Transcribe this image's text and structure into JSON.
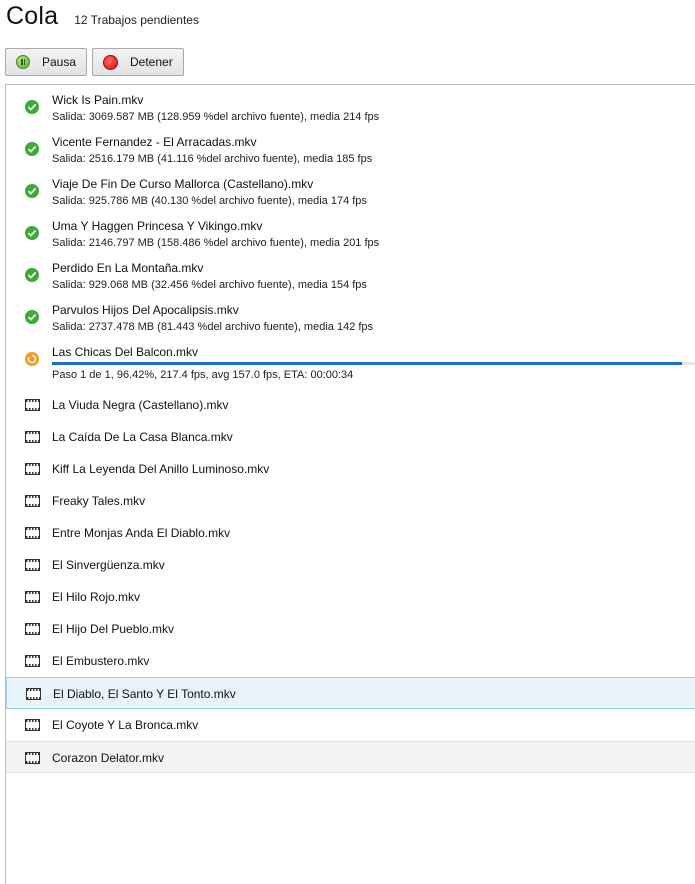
{
  "header": {
    "title": "Cola",
    "subtitle": "12 Trabajos pendientes"
  },
  "toolbar": {
    "pause_label": "Pausa",
    "stop_label": "Detener"
  },
  "colors": {
    "done": "#3cab35",
    "running": "#f59a1d",
    "progress": "#1b6ec2",
    "selected_bg": "#e8f4fa"
  },
  "queue": {
    "completed": [
      {
        "name": "Wick Is Pain.mkv",
        "detail": "Salida: 3069.587 MB (128.959 %del archivo fuente), media 214 fps"
      },
      {
        "name": "Vicente Fernandez - El Arracadas.mkv",
        "detail": "Salida: 2516.179 MB (41.116 %del archivo fuente), media 185 fps"
      },
      {
        "name": "Viaje De Fin De Curso Mallorca (Castellano).mkv",
        "detail": "Salida: 925.786 MB (40.130 %del archivo fuente), media 174 fps"
      },
      {
        "name": "Uma Y Haggen Princesa Y Vikingo.mkv",
        "detail": "Salida: 2146.797 MB (158.486 %del archivo fuente), media 201 fps"
      },
      {
        "name": "Perdido En La Montaña.mkv",
        "detail": "Salida: 929.068 MB (32.456 %del archivo fuente), media 154 fps"
      },
      {
        "name": "Parvulos Hijos Del Apocalipsis.mkv",
        "detail": "Salida: 2737.478 MB (81.443 %del archivo fuente), media 142 fps"
      }
    ],
    "running": {
      "name": "Las Chicas Del Balcon.mkv",
      "detail": "Paso 1 de 1, 96.42%, 217.4 fps, avg 157.0 fps, ETA: 00:00:34",
      "progress": 0.9642
    },
    "pending": [
      "La Viuda Negra (Castellano).mkv",
      "La Caída De La Casa Blanca.mkv",
      "Kiff La Leyenda Del Anillo Luminoso.mkv",
      "Freaky Tales.mkv",
      "Entre Monjas Anda El Diablo.mkv",
      "El Sinvergüenza.mkv",
      "El Hilo Rojo.mkv",
      "El Hijo Del Pueblo.mkv",
      "El Embustero.mkv",
      "El Diablo, El Santo Y El Tonto.mkv",
      "El Coyote Y La Bronca.mkv",
      "Corazon Delator.mkv"
    ],
    "selected_index": 9,
    "hovered_index": 11
  }
}
